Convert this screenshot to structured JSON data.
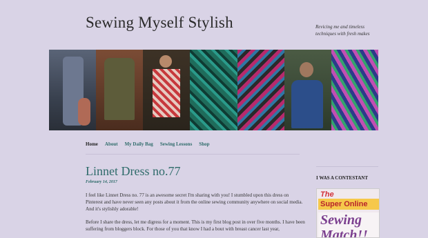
{
  "site": {
    "title": "Sewing Myself Stylish",
    "tagline": "Revicing me and timeless techniques with fresh makes"
  },
  "nav": {
    "items": [
      {
        "label": "Home"
      },
      {
        "label": "About"
      },
      {
        "label": "My Daily Bag"
      },
      {
        "label": "Sewing Lessons"
      },
      {
        "label": "Shop"
      }
    ]
  },
  "post": {
    "title": "Linnet Dress no.77",
    "date": "February 14, 2017",
    "paragraphs": [
      "I feel like Linnet Dress no. 77 is an awesome secret I'm sharing with you! I stumbled upon this dress on Pinterest and have never seen any posts about it from the online sewing community anywhere on social media. And it's stylishly adorable!",
      "Before I share the dress, let me digress for a moment. This is my first blog post in over five months. I have been suffering from bloggers block. For those of you that know I had a bout with breast cancer last year,"
    ]
  },
  "sidebar": {
    "widget_title": "I WAS A CONTESTANT",
    "badge": {
      "the": "The",
      "super": "Super Online",
      "sewing": "Sewing Match!!"
    }
  },
  "colors": {
    "background": "#d9d3e6",
    "accent": "#2e6b6a",
    "text": "#333333"
  }
}
